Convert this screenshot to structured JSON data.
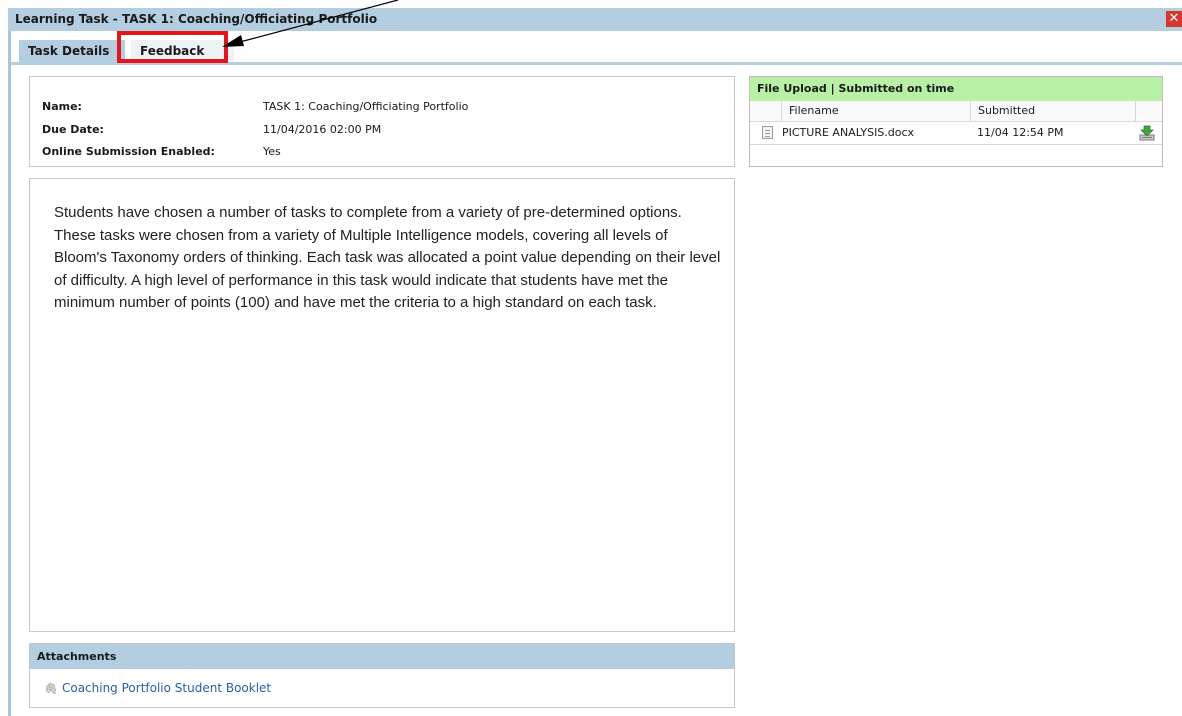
{
  "window": {
    "title": "Learning Task - TASK 1: Coaching/Officiating Portfolio",
    "close_label": "✕"
  },
  "tabs": [
    {
      "label": "Task Details",
      "active": true
    },
    {
      "label": "Feedback",
      "active": false
    }
  ],
  "details": {
    "rows": [
      {
        "label": "Name:",
        "value": "TASK 1: Coaching/Officiating Portfolio"
      },
      {
        "label": "Due Date:",
        "value": "11/04/2016 02:00 PM"
      },
      {
        "label": "Online Submission Enabled:",
        "value": "Yes"
      }
    ]
  },
  "description": "Students have chosen a number of tasks to complete from a variety of pre-determined options. These tasks were chosen from a variety of Multiple Intelligence models, covering all levels of Bloom's Taxonomy orders of thinking. Each task was allocated a point value depending on their level of difficulty. A high level of performance in this task would indicate that students have met the minimum number of points (100) and have met the criteria to a high standard on each task.",
  "upload": {
    "header": "File Upload | Submitted on time",
    "columns": [
      "Filename",
      "Submitted"
    ],
    "files": [
      {
        "filename": "PICTURE ANALYSIS.docx",
        "submitted": "11/04 12:54 PM"
      }
    ]
  },
  "attachments": {
    "header": "Attachments",
    "items": [
      {
        "label": "Coaching Portfolio Student Booklet"
      }
    ]
  },
  "colors": {
    "header_blue": "#b3cde1",
    "upload_green": "#b8f0a5",
    "highlight_red": "#e8141c",
    "link_blue": "#2b5ea8"
  }
}
